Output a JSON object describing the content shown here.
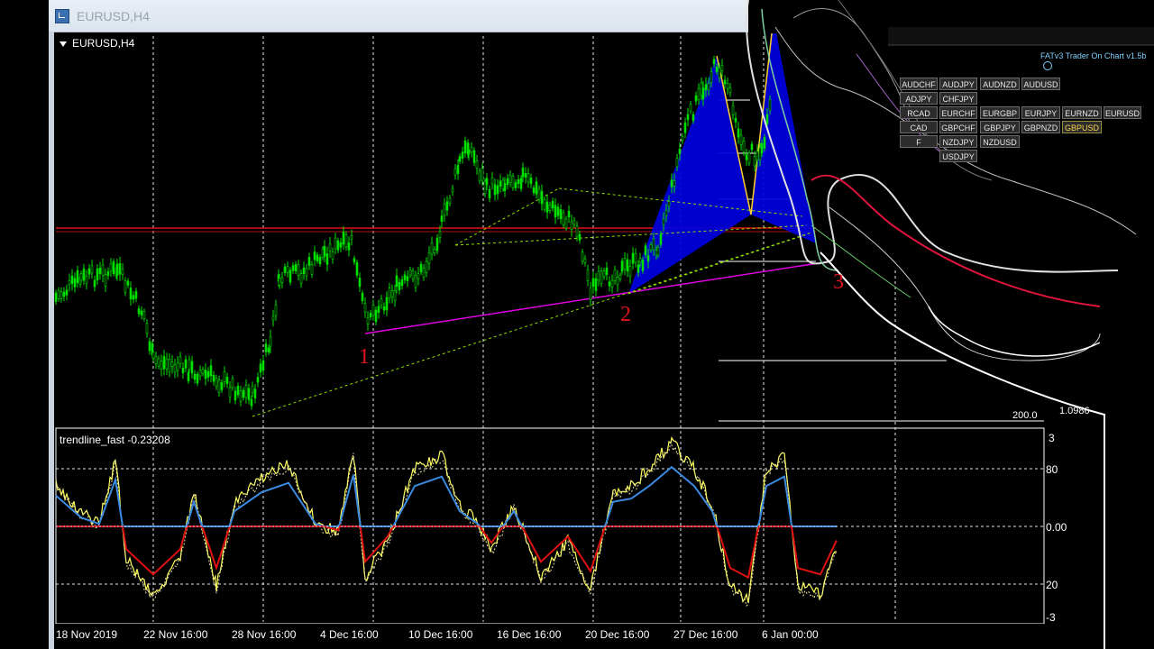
{
  "window": {
    "title": "EURUSD,H4"
  },
  "chart": {
    "title": "EURUSD,H4",
    "indicator_label": "trendline_fast -0.23208",
    "indicator_axis": [
      "3",
      "80",
      "0.00",
      "20",
      "-3"
    ],
    "date_labels": [
      "18 Nov 2019",
      "22 Nov 16:00",
      "28 Nov 16:00",
      "4 Dec 16:00",
      "10 Dec 16:00",
      "16 Dec 16:00",
      "20 Dec 16:00",
      "27 Dec 16:00",
      "6 Jan 00:00"
    ],
    "point_markers": [
      "1",
      "2",
      "3"
    ],
    "fib_label": "200.0",
    "price_label": "1.0986"
  },
  "trader_panel": {
    "title": "FATv3 Trader On Chart v1.5b",
    "symbols": [
      [
        "AUDCHF",
        "AUDJPY",
        "AUDNZD",
        "AUDUSD"
      ],
      [
        "ADJPY",
        "CHFJPY"
      ],
      [
        "RCAD",
        "EURCHF",
        "EURGBP",
        "EURJPY",
        "EURNZD",
        "EURUSD"
      ],
      [
        "CAD",
        "GBPCHF",
        "GBPJPY",
        "GBPNZD",
        "GBPUSD"
      ],
      [
        "F",
        "NZDJPY",
        "NZDUSD"
      ],
      [
        "USDJPY"
      ]
    ],
    "active_symbol": "GBPUSD"
  },
  "colors": {
    "bull": "#00e000",
    "support": "#e000e0",
    "harmonic": "#0000e0",
    "oscillator_fast": "#ffff60",
    "oscillator_up": "#3a8ae0",
    "oscillator_down": "#e01010"
  }
}
